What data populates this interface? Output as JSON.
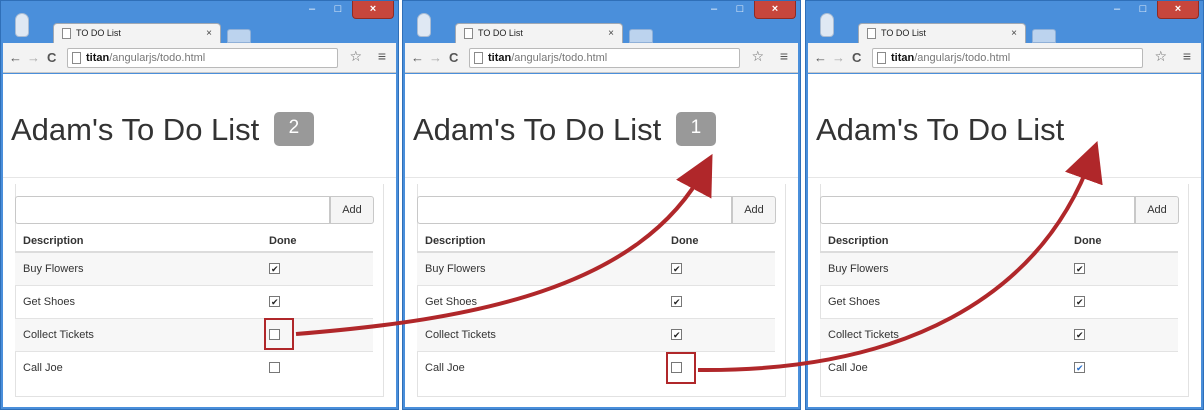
{
  "browser": {
    "tab_title": "TO DO List",
    "tab_close": "×",
    "url_host": "titan",
    "url_path": "/angularjs/todo.html",
    "min_glyph": "–",
    "max_glyph": "□",
    "close_glyph": "×",
    "back_glyph": "←",
    "forward_glyph": "→",
    "reload_glyph": "C",
    "star_glyph": "☆",
    "menu_glyph": "≡"
  },
  "app": {
    "title": "Adam's To Do List",
    "add_label": "Add",
    "col_description": "Description",
    "col_done": "Done"
  },
  "windows": [
    {
      "badge": "2",
      "items": [
        {
          "description": "Buy Flowers",
          "done": true
        },
        {
          "description": "Get Shoes",
          "done": true
        },
        {
          "description": "Collect Tickets",
          "done": false
        },
        {
          "description": "Call Joe",
          "done": false
        }
      ]
    },
    {
      "badge": "1",
      "items": [
        {
          "description": "Buy Flowers",
          "done": true
        },
        {
          "description": "Get Shoes",
          "done": true
        },
        {
          "description": "Collect Tickets",
          "done": true
        },
        {
          "description": "Call Joe",
          "done": false
        }
      ]
    },
    {
      "badge": "",
      "items": [
        {
          "description": "Buy Flowers",
          "done": true
        },
        {
          "description": "Get Shoes",
          "done": true
        },
        {
          "description": "Collect Tickets",
          "done": true
        },
        {
          "description": "Call Joe",
          "done": true
        }
      ]
    }
  ],
  "colors": {
    "window_frame": "#4a8fdb",
    "badge_bg": "#999999",
    "callout": "#b0272a"
  }
}
